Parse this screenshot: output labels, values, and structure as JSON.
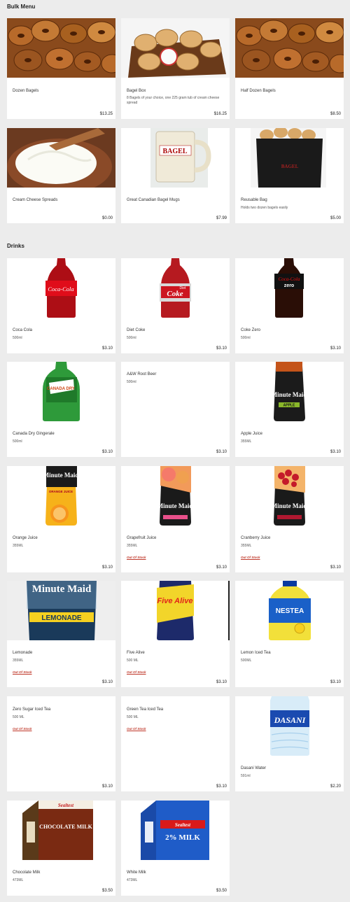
{
  "sections": [
    {
      "title": "Bulk Menu",
      "items": [
        {
          "name": "Dozen Bagels",
          "desc": "",
          "price": "$13.25",
          "image": "bagel-pile"
        },
        {
          "name": "Bagel Box",
          "desc": "8 Bagels of your choice, one 225 gram tub of cream cheese spread",
          "price": "$16.25",
          "image": "bagel-box"
        },
        {
          "name": "Half Dozen Bagels",
          "desc": "",
          "price": "$8.50",
          "image": "bagel-pile"
        },
        {
          "name": "Cream Cheese Spreads",
          "desc": "",
          "price": "$0.00",
          "image": "cream-cheese"
        },
        {
          "name": "Great Canadian Bagel Mugs",
          "desc": "",
          "price": "$7.99",
          "image": "mug"
        },
        {
          "name": "Reusable Bag",
          "desc": "Holds two dozen bagels easily",
          "price": "$5.00",
          "image": "reusable-bag"
        }
      ]
    },
    {
      "title": "Drinks",
      "items": [
        {
          "name": "Coca Cola",
          "desc": "500ml",
          "price": "$3.10",
          "oos": "",
          "image": "coke-bottle"
        },
        {
          "name": "Diet Coke",
          "desc": "500ml",
          "price": "$3.10",
          "oos": "",
          "image": "diet-coke-bottle"
        },
        {
          "name": "Coke Zero",
          "desc": "500ml",
          "price": "$3.10",
          "oos": "",
          "image": "coke-zero-bottle"
        },
        {
          "name": "Canada Dry Gingerale",
          "desc": "500ml",
          "price": "$3.10",
          "oos": "",
          "image": "canada-dry-bottle"
        },
        {
          "name": "A&W Root Beer",
          "desc": "500ml",
          "price": "$3.10",
          "oos": "",
          "image": ""
        },
        {
          "name": "Apple Juice",
          "desc": "355ML",
          "price": "$3.10",
          "oos": "",
          "image": "minute-maid-apple"
        },
        {
          "name": "Orange Juice",
          "desc": "355ML",
          "price": "$3.10",
          "oos": "",
          "image": "minute-maid-orange"
        },
        {
          "name": "Grapefruit Juice",
          "desc": "355ML",
          "price": "$3.10",
          "oos": "Out Of Stock",
          "image": "minute-maid-grapefruit"
        },
        {
          "name": "Cranberry Juice",
          "desc": "355ML",
          "price": "$3.10",
          "oos": "Out Of Stock",
          "image": "minute-maid-cranberry"
        },
        {
          "name": "Lemonade",
          "desc": "355ML",
          "price": "$3.10",
          "oos": "Out Of Stock",
          "image": "minute-maid-lemonade"
        },
        {
          "name": "Five Alive",
          "desc": "500 ML",
          "price": "$3.10",
          "oos": "Out Of Stock",
          "image": "five-alive"
        },
        {
          "name": "Lemon Iced Tea",
          "desc": "500ML",
          "price": "$3.10",
          "oos": "",
          "image": "nestea"
        },
        {
          "name": "Zero Sugar Iced Tea",
          "desc": "500 ML",
          "price": "$3.10",
          "oos": "Out Of Stock",
          "image": ""
        },
        {
          "name": "Green Tea Iced Tea",
          "desc": "500 ML",
          "price": "$3.10",
          "oos": "Out Of Stock",
          "image": ""
        },
        {
          "name": "Dasani Water",
          "desc": "591ml",
          "price": "$2.20",
          "oos": "",
          "image": "dasani"
        },
        {
          "name": "Chocolate Milk",
          "desc": "473ML",
          "price": "$3.50",
          "oos": "",
          "image": "chocolate-milk"
        },
        {
          "name": "White Milk",
          "desc": "473ML",
          "price": "$3.50",
          "oos": "",
          "image": "white-milk"
        }
      ]
    }
  ],
  "image_text": {
    "coke": "Coca-Cola",
    "diet": "Coke",
    "diet_small": "Diet",
    "zero": "zero",
    "canada": "CANADA DRY",
    "mm": "Minute Maid",
    "apple": "APPLE",
    "orange": "ORANGE JUICE",
    "lemonade": "LEMONADE",
    "five": "Five Alive",
    "nestea": "NESTEA",
    "dasani": "DASANI",
    "seal": "Sealtest",
    "choc": "CHOCOLATE MILK",
    "white": "2% MILK",
    "bagel": "BAGEL"
  }
}
